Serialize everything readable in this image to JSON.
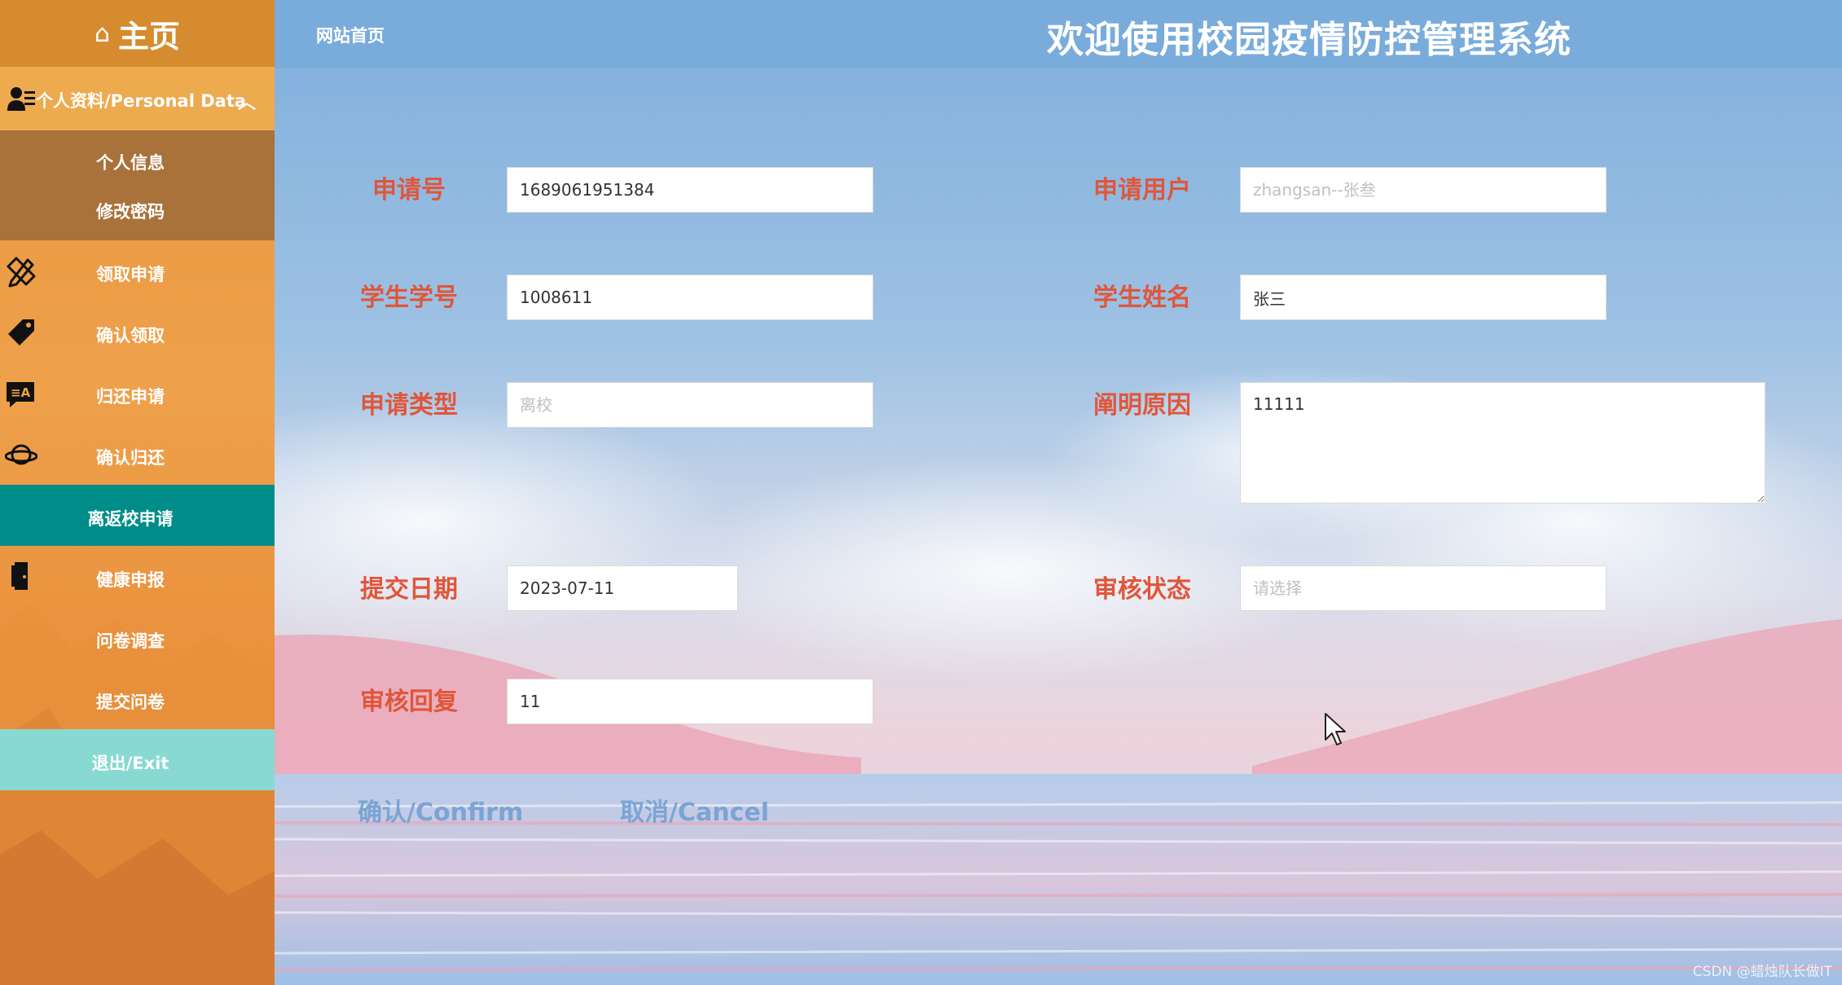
{
  "sidebar": {
    "home_label": "主页",
    "home_icon": "home-outline-icon",
    "personal_label": "个人资料/Personal Data",
    "personal_icon": "id-card-icon",
    "personal_sub": [
      "个人信息",
      "修改密码"
    ],
    "items": [
      {
        "label": "领取申请",
        "icon": "pencil-ruler-icon"
      },
      {
        "label": "确认领取",
        "icon": "tag-icon"
      },
      {
        "label": "归还申请",
        "icon": "translate-chat-icon"
      },
      {
        "label": "确认归还",
        "icon": "planet-icon"
      },
      {
        "label": "离返校申请",
        "icon": ""
      },
      {
        "label": "健康申报",
        "icon": "door-exit-icon"
      },
      {
        "label": "问卷调查",
        "icon": ""
      },
      {
        "label": "提交问卷",
        "icon": ""
      },
      {
        "label": "退出/Exit",
        "icon": ""
      }
    ],
    "active_item": "离返校申请",
    "colors": {
      "base": "#eea04a",
      "active": "#008d89",
      "exit": "#88d9d2",
      "sub": "#a8723a"
    }
  },
  "header": {
    "nav_home": "网站首页",
    "title": "欢迎使用校园疫情防控管理系统"
  },
  "form": {
    "application_no": {
      "label": "申请号",
      "value": "1689061951384"
    },
    "applicant": {
      "label": "申请用户",
      "placeholder": "zhangsan--张叁"
    },
    "student_id": {
      "label": "学生学号",
      "value": "1008611"
    },
    "student_name": {
      "label": "学生姓名",
      "value": "张三"
    },
    "apply_type": {
      "label": "申请类型",
      "placeholder": "离校"
    },
    "reason": {
      "label": "阐明原因",
      "value": "11111"
    },
    "submit_date": {
      "label": "提交日期",
      "value": "2023-07-11"
    },
    "review_status": {
      "label": "审核状态",
      "placeholder": "请选择"
    },
    "review_reply": {
      "label": "审核回复",
      "value": "11"
    },
    "confirm_label": "确认/Confirm",
    "cancel_label": "取消/Cancel",
    "label_color": "#e0563a"
  },
  "watermark": "CSDN @蜡烛队长做IT"
}
